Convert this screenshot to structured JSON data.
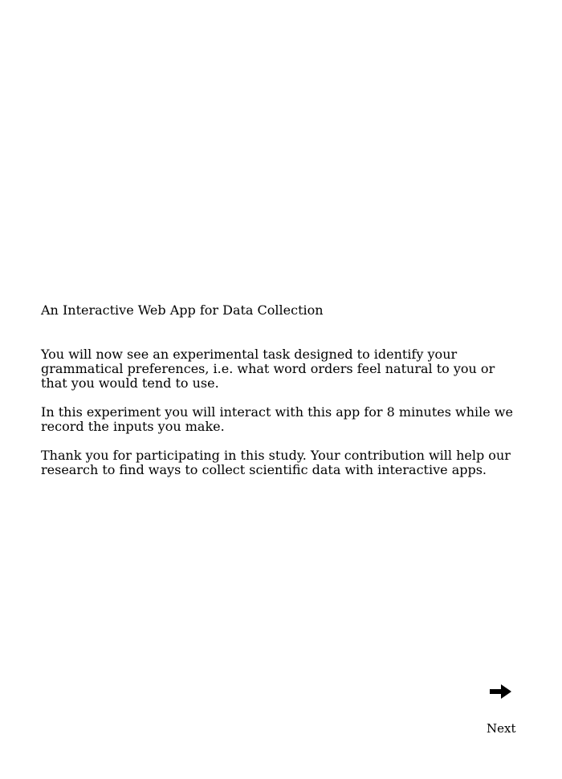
{
  "page": {
    "title": "An Interactive Web App for Data Collection",
    "paragraphs": [
      "You will now see an experimental task designed to identify your grammatical preferences, i.e. what word orders feel natural to you or that you would tend to use.",
      "In this experiment you will interact with this app for 8 minutes while we record the inputs you make.",
      "Thank you for participating in this study. Your contribution will help our research to find ways to collect scientific data with interactive apps."
    ]
  },
  "navigation": {
    "next_label": "Next",
    "next_icon": "arrow-right-icon"
  }
}
